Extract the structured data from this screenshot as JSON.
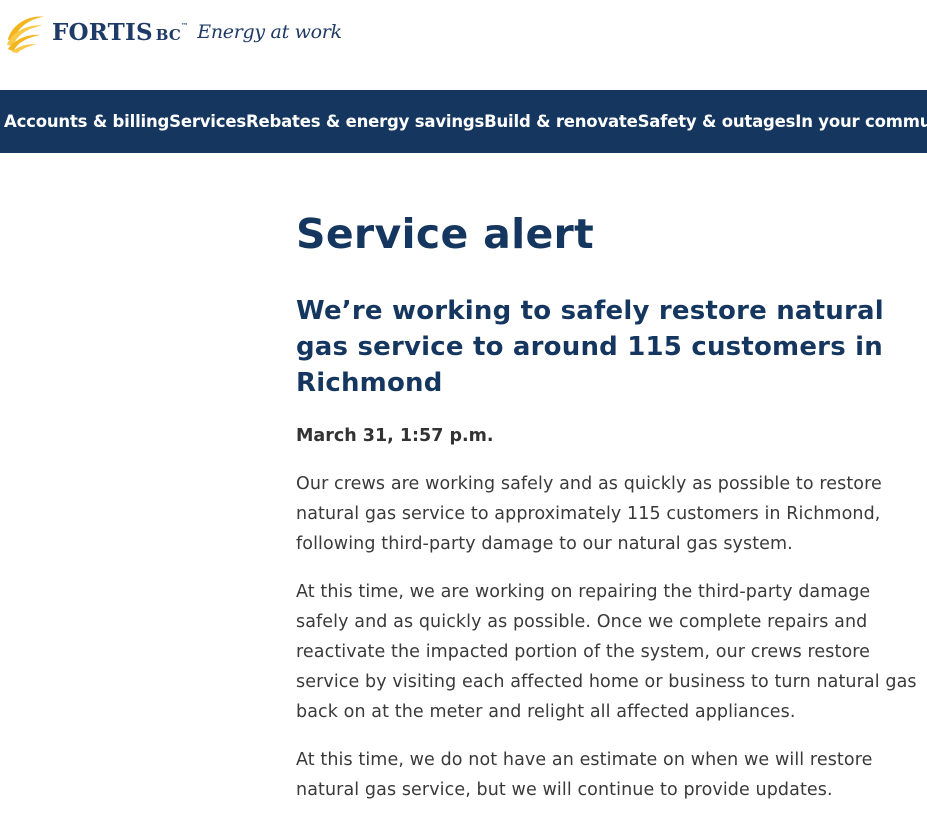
{
  "header": {
    "logo": {
      "brand_name": "FORTIS",
      "brand_suffix": "BC",
      "trademark": "™",
      "tagline": "Energy at work",
      "colors": {
        "gold": "#f2b51e",
        "navy": "#1e3a66"
      }
    }
  },
  "nav": {
    "background": "#15365f",
    "items": [
      {
        "label": "Accounts & billing"
      },
      {
        "label": "Services"
      },
      {
        "label": "Rebates & energy savings"
      },
      {
        "label": "Build & renovate"
      },
      {
        "label": "Safety & outages"
      },
      {
        "label": "In your community"
      }
    ]
  },
  "main": {
    "title": "Service alert",
    "subheading": "We’re working to safely restore natural gas service to around 115 customers in Richmond",
    "dateline": "March 31, 1:57 p.m.",
    "paragraphs": [
      "Our crews are working safely and as quickly as possible to restore natural gas service to approximately 115 customers in Richmond, following third-party damage to our natural gas system.",
      "At this time, we are working on repairing the third-party damage safely and as quickly as possible. Once we complete repairs and reactivate the impacted portion of the system, our crews restore service by visiting each affected home or business to turn natural gas back on at the meter and relight all affected appliances.",
      "At this time, we do not have an estimate on when we will restore natural gas service, but we will continue to provide updates."
    ]
  }
}
